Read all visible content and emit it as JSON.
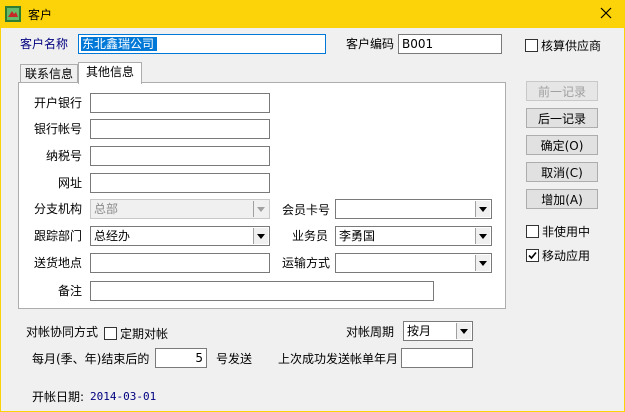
{
  "window": {
    "title": "客户"
  },
  "header": {
    "customer_name_label": "客户名称",
    "customer_name_value": "东北鑫瑞公司",
    "customer_code_label": "客户编码",
    "customer_code_value": "B001",
    "supplier_checkbox_label": "核算供应商",
    "supplier_checked": false
  },
  "tabs": [
    {
      "label": "联系信息",
      "active": false
    },
    {
      "label": "其他信息",
      "active": true
    }
  ],
  "form": {
    "bank_label": "开户银行",
    "bank_value": "",
    "bank_account_label": "银行帐号",
    "bank_account_value": "",
    "tax_no_label": "纳税号",
    "tax_no_value": "",
    "website_label": "网址",
    "website_value": "",
    "branch_label": "分支机构",
    "branch_value": "总部",
    "member_card_label": "会员卡号",
    "member_card_value": "",
    "dept_label": "跟踪部门",
    "dept_value": "总经办",
    "salesman_label": "业务员",
    "salesman_value": "李勇国",
    "delivery_label": "送货地点",
    "delivery_value": "",
    "shipping_label": "运输方式",
    "shipping_value": "",
    "remark_label": "备注",
    "remark_value": ""
  },
  "reconcile": {
    "method_label": "对帐协同方式",
    "regular_label": "定期对帐",
    "regular_checked": false,
    "period_label": "对帐周期",
    "period_value": "按月",
    "end_prefix_label": "每月(季、年)结束后的",
    "end_days_value": "5",
    "end_suffix_label": "号发送",
    "last_sent_label": "上次成功发送帐单年月",
    "last_sent_value": ""
  },
  "footer": {
    "open_date_label": "开帐日期:",
    "open_date_value": "2014-03-01"
  },
  "buttons": {
    "prev_label": "前一记录",
    "next_label": "后一记录",
    "ok_label": "确定(O)",
    "cancel_label": "取消(C)",
    "add_label": "增加(A)"
  },
  "options": {
    "inactive_label": "非使用中",
    "inactive_checked": false,
    "mobile_label": "移动应用",
    "mobile_checked": true
  },
  "colors": {
    "titlebar": "#fcd209",
    "selection": "#0078d7",
    "date_text": "#000080"
  }
}
